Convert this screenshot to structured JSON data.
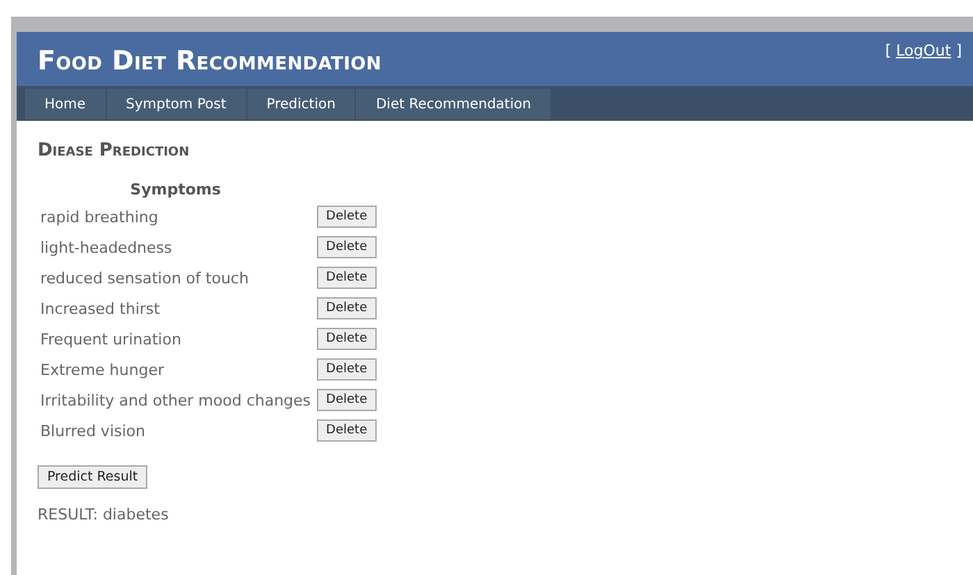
{
  "header": {
    "title": "Food Diet Recommendation",
    "logout": {
      "open": "[",
      "link": "LogOut",
      "close": "]"
    }
  },
  "menu": [
    {
      "label": "Home"
    },
    {
      "label": "Symptom Post"
    },
    {
      "label": "Prediction"
    },
    {
      "label": "Diet Recommendation"
    }
  ],
  "page_title": "Diease Prediction",
  "symptoms": {
    "heading": "Symptoms",
    "rows": [
      {
        "name": "rapid breathing",
        "action": "Delete"
      },
      {
        "name": "light-headedness",
        "action": "Delete"
      },
      {
        "name": "reduced sensation of touch",
        "action": "Delete"
      },
      {
        "name": "Increased thirst",
        "action": "Delete"
      },
      {
        "name": "Frequent urination",
        "action": "Delete"
      },
      {
        "name": "Extreme hunger",
        "action": "Delete"
      },
      {
        "name": "Irritability and other mood changes",
        "action": "Delete"
      },
      {
        "name": "Blurred vision",
        "action": "Delete"
      }
    ]
  },
  "predict_button": "Predict Result",
  "result": "RESULT: diabetes"
}
